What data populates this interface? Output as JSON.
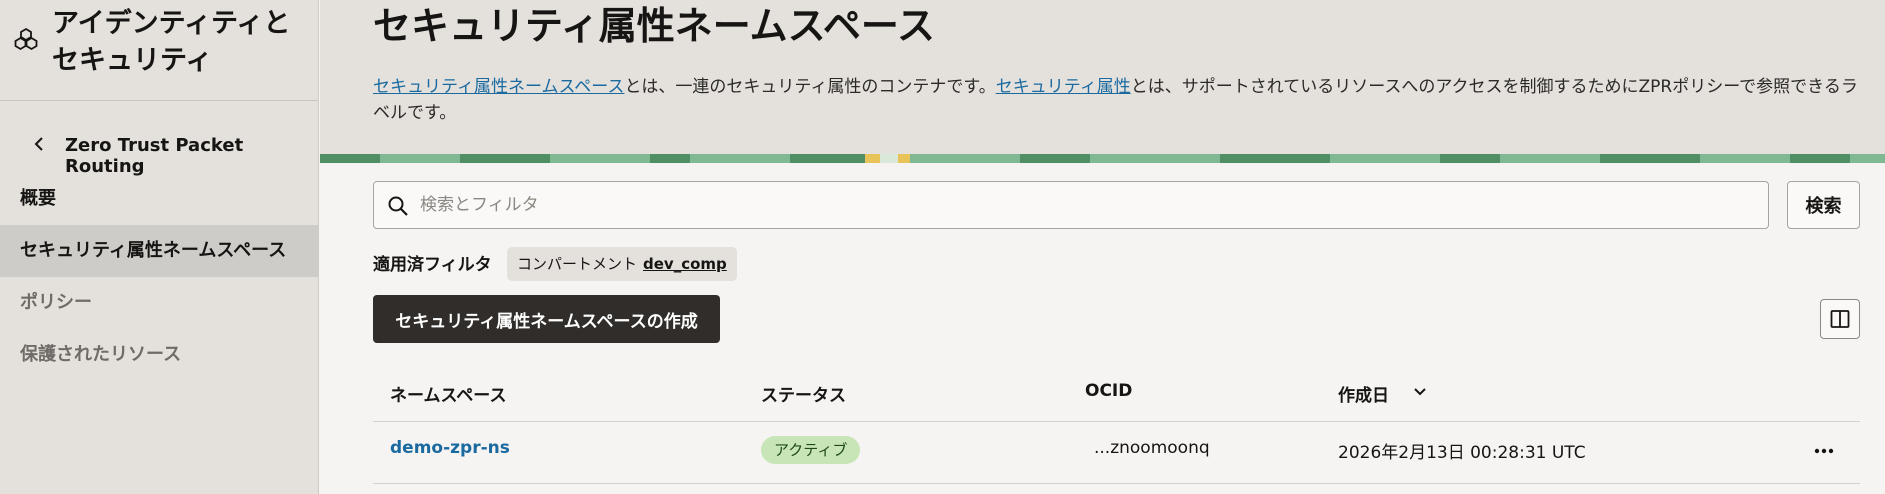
{
  "sidebar": {
    "title": "アイデンティティとセキュリティ",
    "back_label": "Zero Trust Packet Routing",
    "items": [
      {
        "label": "概要"
      },
      {
        "label": "セキュリティ属性ネームスペース"
      },
      {
        "label": "ポリシー"
      },
      {
        "label": "保護されたリソース"
      }
    ]
  },
  "header": {
    "title": "セキュリティ属性ネームスペース",
    "desc_link1": "セキュリティ属性ネームスペース",
    "desc_text1": "とは、一連のセキュリティ属性のコンテナです。",
    "desc_link2": "セキュリティ属性",
    "desc_text2": "とは、サポートされているリソースへのアクセスを制御するためにZPRポリシーで参照できるラベルです。"
  },
  "search": {
    "placeholder": "検索とフィルタ",
    "button_label": "検索"
  },
  "filters": {
    "label": "適用済フィルタ",
    "chip_key": "コンパートメント",
    "chip_value": "dev_comp"
  },
  "actions": {
    "create_label": "セキュリティ属性ネームスペースの作成"
  },
  "table": {
    "columns": [
      "ネームスペース",
      "ステータス",
      "OCID",
      "作成日"
    ],
    "rows": [
      {
        "namespace": "demo-zpr-ns",
        "status": "アクティブ",
        "ocid": "...znoomoonq",
        "created": "2026年2月13日 00:28:31 UTC"
      }
    ]
  },
  "colors": {
    "accent_link": "#1a6aa0",
    "primary_button": "#312d2a",
    "status_active_bg": "#c7e5b6"
  },
  "icons": [
    "app-logo-icon",
    "chevron-left-icon",
    "search-icon",
    "column-layout-icon",
    "sort-chevron-down-icon",
    "more-actions-icon"
  ]
}
